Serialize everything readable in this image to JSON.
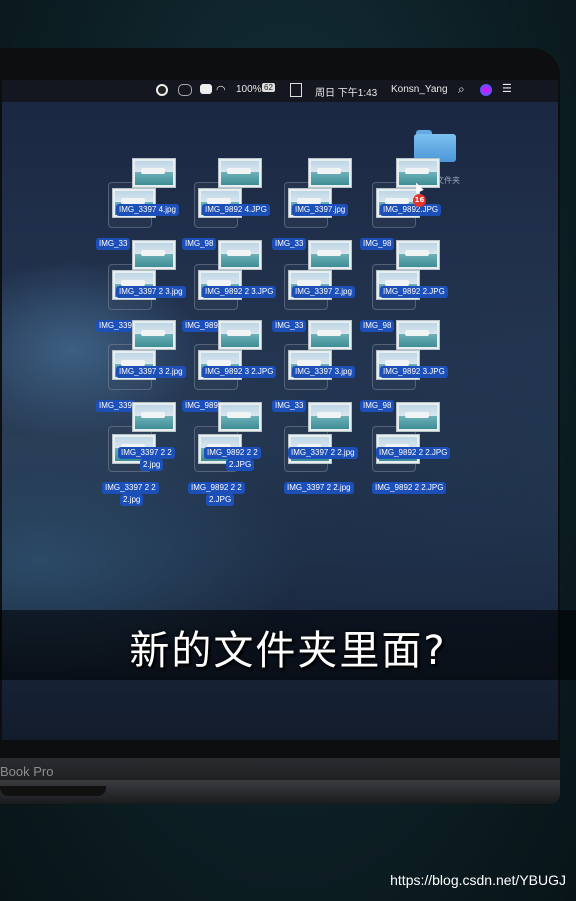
{
  "menubar": {
    "battery": "100%",
    "battery_badge": "62",
    "datetime": "周日 下午1:43",
    "user": "Konsn_Yang"
  },
  "desktop": {
    "folder_label": "文件夹",
    "drag_count": "16",
    "files": [
      {
        "label": "IMG_3397 4.jpg",
        "back_label": "IMG_33"
      },
      {
        "label": "IMG_9892 4.JPG",
        "back_label": "IMG_98"
      },
      {
        "label": "IMG_3397.jpg",
        "back_label": "IMG_33"
      },
      {
        "label": "IMG_9892.JPG",
        "back_label": "IMG_98"
      },
      {
        "label": "IMG_3397 2 3.jpg",
        "back_label": "IMG_339"
      },
      {
        "label": "IMG_9892 2 3.JPG",
        "back_label": "IMG_989"
      },
      {
        "label": "IMG_3397 2.jpg",
        "back_label": "IMG_33"
      },
      {
        "label": "IMG_9892 2.JPG",
        "back_label": "IMG_98"
      },
      {
        "label": "IMG_3397 3 2.jpg",
        "back_label": "IMG_339"
      },
      {
        "label": "IMG_9892 3 2.JPG",
        "back_label": "IMG_989"
      },
      {
        "label": "IMG_3397 3.jpg",
        "back_label": "IMG_33"
      },
      {
        "label": "IMG_9892 3.JPG",
        "back_label": "IMG_98"
      }
    ],
    "bottom_row": [
      {
        "label_line1": "IMG_3397 2 2",
        "label_line2": "2.jpg",
        "under1": "IMG_3397 2 2",
        "under2": "2.jpg"
      },
      {
        "label_line1": "IMG_9892 2 2",
        "label_line2": "2.JPG",
        "under1": "IMG_9892 2 2",
        "under2": "2.JPG"
      },
      {
        "label_line1": "IMG_3397 2 2.jpg",
        "under1": "IMG_3397 2 2.jpg"
      },
      {
        "label_line1": "IMG_9892 2 2.JPG",
        "under1": "IMG_9892 2 2.JPG"
      }
    ]
  },
  "subtitle": "新的文件夹里面?",
  "laptop_brand": "Book Pro",
  "dock": {
    "apps": [
      {
        "name": "facetime-icon",
        "color": "#2fbf4f"
      },
      {
        "name": "keynote-edit-icon",
        "color": "#e9a23b"
      },
      {
        "name": "numbers-icon",
        "color": "#3c9f4a"
      },
      {
        "name": "keynote-icon",
        "color": "#2f7ff0"
      },
      {
        "name": "itunes-icon",
        "color": "#f2f2f2"
      },
      {
        "name": "ibooks-icon",
        "color": "#f08a1c"
      },
      {
        "name": "app-store-icon",
        "color": "#1f8ff5"
      },
      {
        "name": "system-preferences-icon",
        "color": "#8d9199"
      },
      {
        "name": "quicktime-icon",
        "color": "#2d3340"
      },
      {
        "name": "feedback-icon",
        "color": "#9a4fd6"
      },
      {
        "name": "downloads-folder-icon",
        "color": "#5aa9e6"
      },
      {
        "name": "trash-icon",
        "color": "#b8bcc2"
      }
    ]
  },
  "watermark": "https://blog.csdn.net/YBUGJ"
}
